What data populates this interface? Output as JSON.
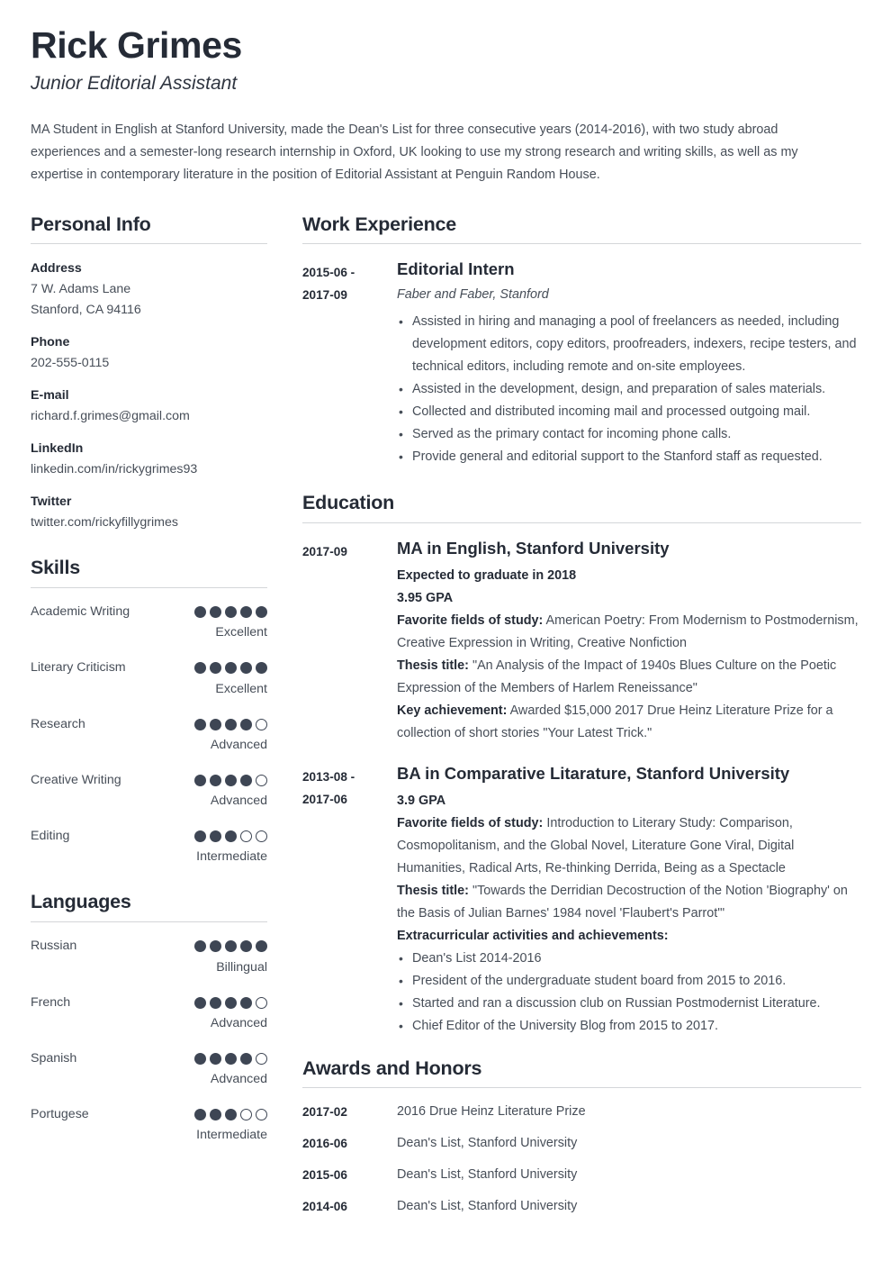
{
  "header": {
    "name": "Rick Grimes",
    "job_title": "Junior Editorial Assistant",
    "summary": "MA Student in English at Stanford University, made the Dean's List for three consecutive years (2014-2016), with two study abroad experiences and a semester-long research internship in Oxford, UK looking to use my strong research and writing skills, as well as my expertise in contemporary literature in the position of Editorial Assistant at Penguin Random House."
  },
  "personal_info": {
    "title": "Personal Info",
    "blocks": [
      {
        "label": "Address",
        "values": [
          "7 W. Adams Lane",
          "Stanford, CA 94116"
        ]
      },
      {
        "label": "Phone",
        "values": [
          "202-555-0115"
        ]
      },
      {
        "label": "E-mail",
        "values": [
          "richard.f.grimes@gmail.com"
        ]
      },
      {
        "label": "LinkedIn",
        "values": [
          "linkedin.com/in/rickygrimes93"
        ]
      },
      {
        "label": "Twitter",
        "values": [
          "twitter.com/rickyfillygrimes"
        ]
      }
    ]
  },
  "skills": {
    "title": "Skills",
    "max_dots": 5,
    "items": [
      {
        "name": "Academic Writing",
        "rating": 5,
        "level": "Excellent"
      },
      {
        "name": "Literary Criticism",
        "rating": 5,
        "level": "Excellent"
      },
      {
        "name": "Research",
        "rating": 4,
        "level": "Advanced"
      },
      {
        "name": "Creative Writing",
        "rating": 4,
        "level": "Advanced"
      },
      {
        "name": "Editing",
        "rating": 3,
        "level": "Intermediate"
      }
    ]
  },
  "languages": {
    "title": "Languages",
    "max_dots": 5,
    "items": [
      {
        "name": "Russian",
        "rating": 5,
        "level": "Billingual"
      },
      {
        "name": "French",
        "rating": 4,
        "level": "Advanced"
      },
      {
        "name": "Spanish",
        "rating": 4,
        "level": "Advanced"
      },
      {
        "name": "Portugese",
        "rating": 3,
        "level": "Intermediate"
      }
    ]
  },
  "work_experience": {
    "title": "Work Experience",
    "entries": [
      {
        "date": "2015-06 - 2017-09",
        "date_lines": [
          "2015-06 -",
          "2017-09"
        ],
        "title": "Editorial Intern",
        "subtitle": "Faber and Faber, Stanford",
        "bullets": [
          "Assisted in hiring and managing a pool of freelancers as needed, including development editors, copy editors, proofreaders, indexers, recipe testers, and technical editors, including remote and on-site employees.",
          "Assisted in the development, design, and preparation of sales materials.",
          "Collected and distributed incoming mail and processed outgoing mail.",
          "Served as the primary contact for incoming phone calls.",
          "Provide general and editorial support to the Stanford staff as requested."
        ]
      }
    ]
  },
  "education": {
    "title": "Education",
    "entries": [
      {
        "date_lines": [
          "2017-09"
        ],
        "title": "MA in English, Stanford University",
        "lines": [
          {
            "label": "Expected to graduate in 2018",
            "text": ""
          },
          {
            "label": "3.95 GPA",
            "text": ""
          },
          {
            "label": "Favorite fields of study:",
            "text": " American Poetry: From Modernism to Postmodernism, Creative Expression in Writing, Creative Nonfiction"
          },
          {
            "label": "Thesis title:",
            "text": " \"An Analysis of the Impact of 1940s Blues Culture on the Poetic Expression of the Members of Harlem Reneissance\""
          },
          {
            "label": "Key achievement:",
            "text": " Awarded $15,000 2017 Drue Heinz Literature Prize for a collection of short stories \"Your Latest Trick.\""
          }
        ],
        "extra_heading": "",
        "bullets": []
      },
      {
        "date_lines": [
          "2013-08 -",
          "2017-06"
        ],
        "title": "BA in Comparative Litarature, Stanford University",
        "lines": [
          {
            "label": "3.9 GPA",
            "text": ""
          },
          {
            "label": "Favorite fields of study:",
            "text": " Introduction to Literary Study: Comparison, Cosmopolitanism, and the Global Novel, Literature Gone Viral, Digital Humanities, Radical Arts, Re-thinking Derrida, Being as a Spectacle"
          },
          {
            "label": "Thesis title:",
            "text": " \"Towards the Derridian Decostruction of the Notion 'Biography' on the Basis of Julian Barnes' 1984 novel 'Flaubert's Parrot'\""
          }
        ],
        "extra_heading": "Extracurricular activities and achievements:",
        "bullets": [
          "Dean's List 2014-2016",
          "President of the undergraduate student board from 2015 to 2016.",
          "Started and ran a discussion club on Russian Postmodernist Literature.",
          "Chief Editor of the University Blog from 2015 to 2017."
        ]
      }
    ]
  },
  "awards": {
    "title": "Awards and Honors",
    "rows": [
      {
        "date": "2017-02",
        "text": "2016 Drue Heinz Literature Prize"
      },
      {
        "date": "2016-06",
        "text": "Dean's List, Stanford University"
      },
      {
        "date": "2015-06",
        "text": "Dean's List, Stanford University"
      },
      {
        "date": "2014-06",
        "text": "Dean's List, Stanford University"
      }
    ]
  },
  "colors": {
    "heading": "#252b36",
    "body_text": "#474e58",
    "rule": "#d4d6d9",
    "dot_filled": "#3e4654",
    "background": "#ffffff"
  }
}
